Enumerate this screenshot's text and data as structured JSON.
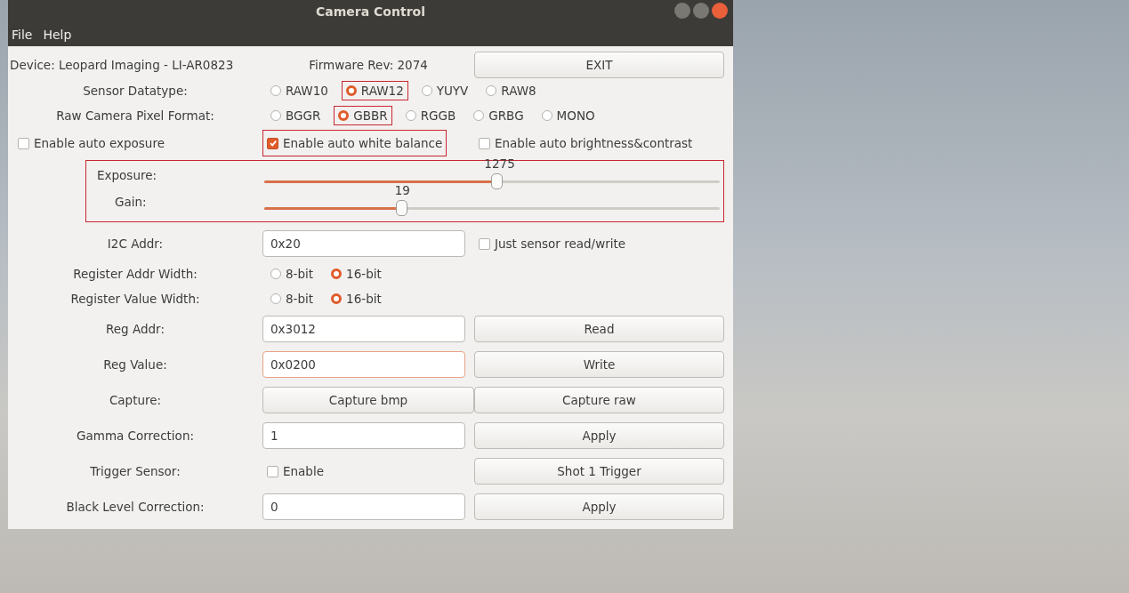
{
  "window": {
    "title": "Camera Control"
  },
  "menu": [
    "File",
    "Help"
  ],
  "header": {
    "device": "Device: Leopard Imaging - LI-AR0823",
    "firmware": "Firmware Rev: 2074",
    "button": "EXIT"
  },
  "rows": [
    {
      "kind": "radio",
      "label": "Sensor Datatype:",
      "options": [
        {
          "label": "RAW10",
          "selected": false,
          "highlighted": false
        },
        {
          "label": "RAW12",
          "selected": true,
          "highlighted": true
        },
        {
          "label": "YUYV",
          "selected": false,
          "highlighted": false
        },
        {
          "label": "RAW8",
          "selected": false,
          "highlighted": false
        }
      ]
    },
    {
      "kind": "radio",
      "label": "Raw Camera Pixel Format:",
      "options": [
        {
          "label": "BGGR",
          "selected": false,
          "highlighted": false
        },
        {
          "label": "GBBR",
          "selected": true,
          "highlighted": true
        },
        {
          "label": "RGGB",
          "selected": false,
          "highlighted": false
        },
        {
          "label": "GRBG",
          "selected": false,
          "highlighted": false
        },
        {
          "label": "MONO",
          "selected": false,
          "highlighted": false
        }
      ]
    },
    {
      "kind": "checks",
      "items": [
        {
          "label": "Enable auto exposure",
          "checked": false,
          "highlighted": false
        },
        {
          "label": "Enable auto white balance",
          "checked": true,
          "highlighted": true
        },
        {
          "label": "Enable auto brightness&contrast",
          "checked": false,
          "highlighted": false
        }
      ]
    },
    {
      "kind": "sliders",
      "highlighted": true,
      "sliders": [
        {
          "label": "Exposure:",
          "value": "1275",
          "level": 0.51
        },
        {
          "label": "Gain:",
          "value": "19",
          "level": 0.3
        }
      ]
    },
    {
      "kind": "form",
      "label": "I2C Addr:",
      "cells": [
        {
          "kind": "field",
          "value": "0x20",
          "focused": false
        },
        {
          "kind": "check",
          "label": "Just sensor read/write",
          "checked": false
        }
      ]
    },
    {
      "kind": "radio",
      "label": "Register Addr Width:",
      "options": [
        {
          "label": "8-bit",
          "selected": false,
          "highlighted": false
        },
        {
          "label": "16-bit",
          "selected": true,
          "highlighted": false
        }
      ]
    },
    {
      "kind": "radio",
      "label": "Register Value Width:",
      "options": [
        {
          "label": "8-bit",
          "selected": false,
          "highlighted": false
        },
        {
          "label": "16-bit",
          "selected": true,
          "highlighted": false
        }
      ]
    },
    {
      "kind": "form",
      "label": "Reg Addr:",
      "cells": [
        {
          "kind": "field",
          "value": "0x3012",
          "focused": false
        },
        {
          "kind": "button",
          "label": "Read"
        }
      ]
    },
    {
      "kind": "form",
      "label": "Reg Value:",
      "cells": [
        {
          "kind": "field",
          "value": "0x0200",
          "focused": true
        },
        {
          "kind": "button",
          "label": "Write"
        }
      ]
    },
    {
      "kind": "form",
      "label": "Capture:",
      "cells": [
        {
          "kind": "button",
          "label": "Capture bmp"
        },
        {
          "kind": "button",
          "label": "Capture raw"
        }
      ]
    },
    {
      "kind": "form",
      "label": "Gamma Correction:",
      "cells": [
        {
          "kind": "field",
          "value": "1",
          "focused": false
        },
        {
          "kind": "button",
          "label": "Apply"
        }
      ]
    },
    {
      "kind": "form",
      "label": "Trigger Sensor:",
      "cells": [
        {
          "kind": "check",
          "label": "Enable",
          "checked": false
        },
        {
          "kind": "button",
          "label": "Shot 1 Trigger"
        }
      ]
    },
    {
      "kind": "form",
      "label": "Black Level Correction:",
      "cells": [
        {
          "kind": "field",
          "value": "0",
          "focused": false
        },
        {
          "kind": "button",
          "label": "Apply"
        }
      ]
    }
  ]
}
